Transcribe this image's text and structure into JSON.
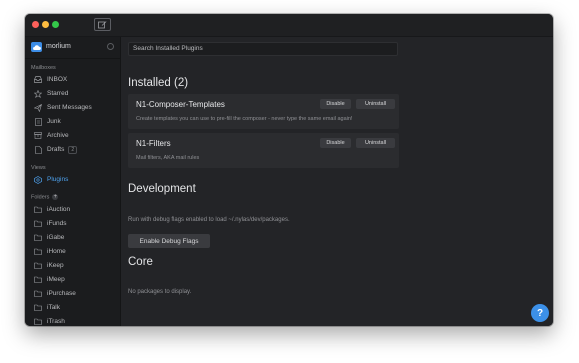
{
  "account": {
    "name": "morlium"
  },
  "sidebar": {
    "mailboxes_label": "Mailboxes",
    "mailboxes": [
      {
        "label": "INBOX",
        "icon": "inbox-icon"
      },
      {
        "label": "Starred",
        "icon": "star-icon"
      },
      {
        "label": "Sent Messages",
        "icon": "send-icon"
      },
      {
        "label": "Junk",
        "icon": "junk-icon"
      },
      {
        "label": "Archive",
        "icon": "archive-icon"
      },
      {
        "label": "Drafts",
        "icon": "drafts-icon",
        "badge": "2"
      }
    ],
    "views_label": "Views",
    "views": [
      {
        "label": "Plugins",
        "icon": "plugins-icon",
        "active": true
      }
    ],
    "folders_label": "Folders",
    "folders": [
      {
        "label": "iAuction"
      },
      {
        "label": "iFunds"
      },
      {
        "label": "iGabe"
      },
      {
        "label": "iHome"
      },
      {
        "label": "iKeep"
      },
      {
        "label": "iMeep"
      },
      {
        "label": "iPurchase"
      },
      {
        "label": "iTalk"
      },
      {
        "label": "iTrash"
      }
    ]
  },
  "main": {
    "search_placeholder": "Search Installed Plugins",
    "installed_heading": "Installed (2)",
    "plugins": [
      {
        "title": "N1-Composer-Templates",
        "description": "Create templates you can use to pre-fill the composer - never type the same email again!",
        "disable_label": "Disable",
        "uninstall_label": "Uninstall"
      },
      {
        "title": "N1-Filters",
        "description": "Mail filters, AKA mail rules",
        "disable_label": "Disable",
        "uninstall_label": "Uninstall"
      }
    ],
    "development_heading": "Development",
    "development_note": "Run with debug flags enabled to load ~/.nylas/dev/packages.",
    "debug_button": "Enable Debug Flags",
    "core_heading": "Core",
    "core_note": "No packages to display."
  },
  "help_label": "?",
  "colors": {
    "accent": "#3c90e8",
    "traffic_close": "#fc605b",
    "traffic_min": "#fdbc40",
    "traffic_max": "#34c84a"
  }
}
